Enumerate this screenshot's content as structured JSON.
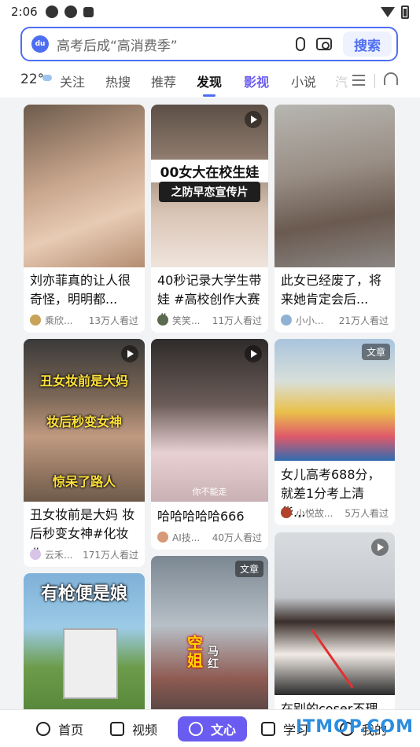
{
  "status": {
    "time": "2:06"
  },
  "search": {
    "placeholder": "高考后成“高消费季”",
    "button": "搜索"
  },
  "tabs": {
    "weather": "22°",
    "items": [
      "关注",
      "热搜",
      "推荐",
      "发现",
      "影视",
      "小说",
      "汽"
    ],
    "active": "发现"
  },
  "feed": {
    "col1": [
      {
        "title": "刘亦菲真的让人很奇怪，明明都...",
        "author": "乘欣...",
        "views": "13万人看过"
      },
      {
        "overlay1": "丑女妆前是大妈",
        "overlay2": "妆后秒变女神",
        "overlay3": "惊呆了路人",
        "title": "丑女妆前是大妈 妆后秒变女神#化妆#",
        "author": "云禾...",
        "views": "171万人看过"
      },
      {
        "overlay1": "有枪便是娘"
      }
    ],
    "col2": [
      {
        "overlay1": "00女大在校生娃",
        "overlay2": "之防早恋宣传片",
        "title": "40秒记录大学生带娃 #高校创作大赛#",
        "author": "笑笑...",
        "views": "11万人看过"
      },
      {
        "caption": "你不能走",
        "title": "哈哈哈哈哈666",
        "author": "AI技...",
        "views": "40万人看过"
      },
      {
        "badge": "文章",
        "overlay1": "空姐",
        "overlay2": "马红"
      }
    ],
    "col3": [
      {
        "title": "此女已经废了，将来她肯定会后...",
        "author": "小小...",
        "views": "21万人看过"
      },
      {
        "badge": "文章",
        "title": "女儿高考688分，就差1分考上清华...",
        "author": "小悦故...",
        "views": "5万人看过"
      },
      {
        "title": "在别的coser不理你"
      }
    ]
  },
  "bottom_nav": {
    "home": "首页",
    "video": "视频",
    "wenxin": "文心",
    "learn": "学习",
    "mine": "我的"
  },
  "watermark": "ITMOP.COM"
}
